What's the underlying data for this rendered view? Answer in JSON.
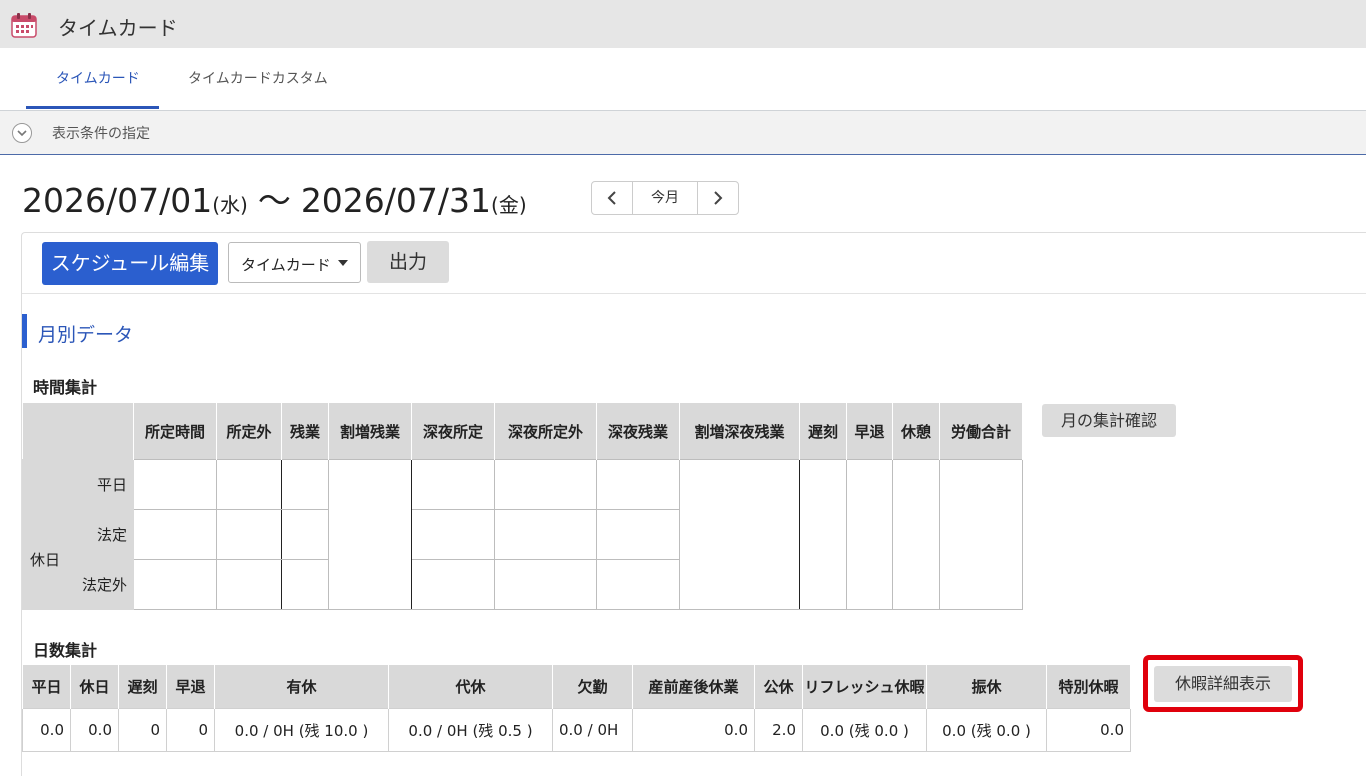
{
  "app": {
    "title": "タイムカード",
    "icon": "calendar-icon"
  },
  "tabs": [
    {
      "label": "タイムカード",
      "active": true
    },
    {
      "label": "タイムカードカスタム",
      "active": false
    }
  ],
  "filter": {
    "label": "表示条件の指定",
    "icon": "chevron-down-icon"
  },
  "period": {
    "start": "2026/07/01",
    "start_dow": "(水)",
    "separator": "〜",
    "end": "2026/07/31",
    "end_dow": "(金)"
  },
  "nav": {
    "today": "今月",
    "prev_icon": "chevron-left-icon",
    "next_icon": "chevron-right-icon"
  },
  "toolbar": {
    "schedule_edit": "スケジュール編集",
    "view_select": "タイムカード",
    "output": "出力"
  },
  "section": {
    "title": "月別データ"
  },
  "time_summary": {
    "title": "時間集計",
    "columns": [
      "所定時間",
      "所定外",
      "残業",
      "割増残業",
      "深夜所定",
      "深夜所定外",
      "深夜残業",
      "割増深夜残業",
      "遅刻",
      "早退",
      "休憩",
      "労働合計"
    ],
    "rows": {
      "weekday": "平日",
      "holiday": "休日",
      "legal": "法定",
      "non_legal": "法定外"
    },
    "confirm_button": "月の集計確認"
  },
  "day_summary": {
    "title": "日数集計",
    "columns": [
      "平日",
      "休日",
      "遅刻",
      "早退",
      "有休",
      "代休",
      "欠勤",
      "産前産後休業",
      "公休",
      "リフレッシュ休暇",
      "振休",
      "特別休暇"
    ],
    "values": [
      "0.0",
      "0.0",
      "0",
      "0",
      "0.0 / 0H (残 10.0 )",
      "0.0 / 0H (残 0.5 )",
      "0.0 / 0H",
      "0.0",
      "2.0",
      "0.0 (残 0.0 )",
      "0.0 (残 0.0 )",
      "0.0"
    ],
    "detail_button": "休暇詳細表示"
  },
  "colors": {
    "accent": "#2b5fcf",
    "highlight": "#e0000c",
    "header_gray": "#d9d9d9"
  }
}
